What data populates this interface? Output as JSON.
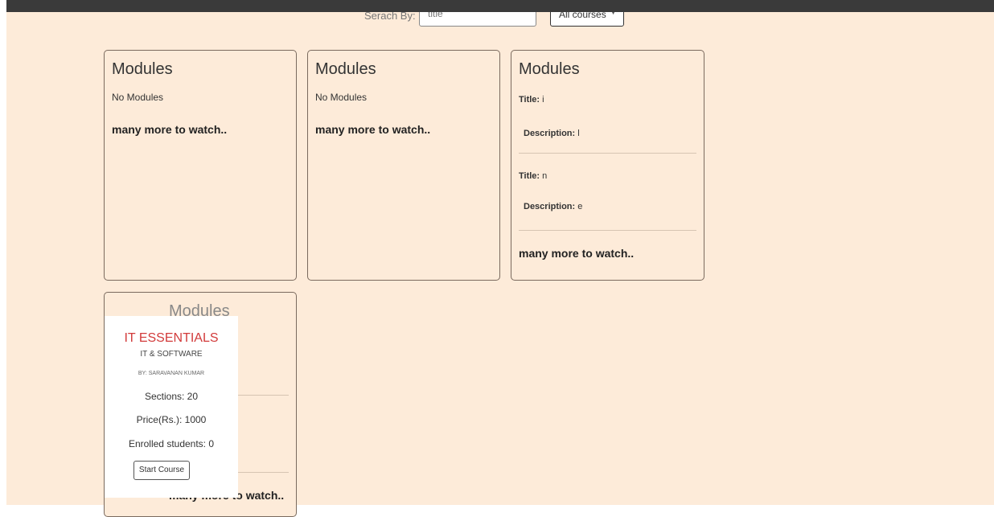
{
  "search": {
    "label": "Serach By:",
    "placeholder": "title",
    "filter_selected": "All courses",
    "filter_icon": "chevron-down-icon"
  },
  "cards": [
    {
      "title": "Modules",
      "empty_text": "No Modules",
      "more_text": "many more to watch.."
    },
    {
      "title": "Modules",
      "empty_text": "No Modules",
      "more_text": "many more to watch.."
    },
    {
      "title": "Modules",
      "modules": [
        {
          "title_label": "Title:",
          "title_value": "i",
          "desc_label": "Description:",
          "desc_value": "l"
        },
        {
          "title_label": "Title:",
          "title_value": "n",
          "desc_label": "Description:",
          "desc_value": "e"
        }
      ],
      "more_text": "many more to watch.."
    },
    {
      "title": "Modules",
      "more_text": "many more to watch.."
    }
  ],
  "course_popup": {
    "title": "IT ESSENTIALS",
    "category": "IT & SOFTWARE",
    "author": "BY: SARAVANAN KUMAR",
    "sections": "Sections: 20",
    "price": "Price(Rs.): 1000",
    "enrolled": "Enrolled students: 0",
    "start_button": "Start Course"
  },
  "colors": {
    "background": "#fdebd9",
    "topbar": "#3a3a3a",
    "course_title": "#d23b3b"
  }
}
